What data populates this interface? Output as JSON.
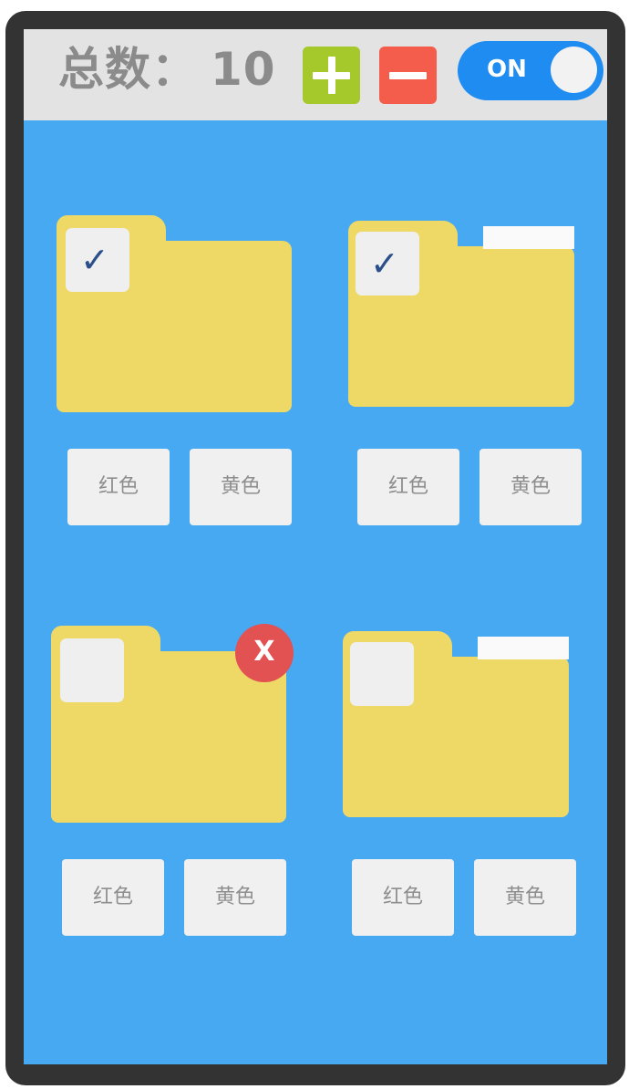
{
  "header": {
    "total_label": "总数：",
    "total_count": "10",
    "toggle_label": "ON"
  },
  "colors": {
    "add": "#a5c92a",
    "remove": "#f45c4b",
    "toggle": "#1e8cf0",
    "folder": "#eed967",
    "background": "#47a9f2",
    "close": "#e35252"
  },
  "icons": {
    "add": "plus-icon",
    "remove": "minus-icon",
    "close": "close-icon",
    "check": "checkmark-icon"
  },
  "folders": [
    {
      "checked": true,
      "check_glyph": "✓",
      "red_label": "红色",
      "yellow_label": "黄色"
    },
    {
      "checked": true,
      "check_glyph": "✓",
      "red_label": "红色",
      "yellow_label": "黄色"
    },
    {
      "checked": false,
      "close_glyph": "X",
      "red_label": "红色",
      "yellow_label": "黄色"
    },
    {
      "checked": false,
      "red_label": "红色",
      "yellow_label": "黄色"
    }
  ]
}
